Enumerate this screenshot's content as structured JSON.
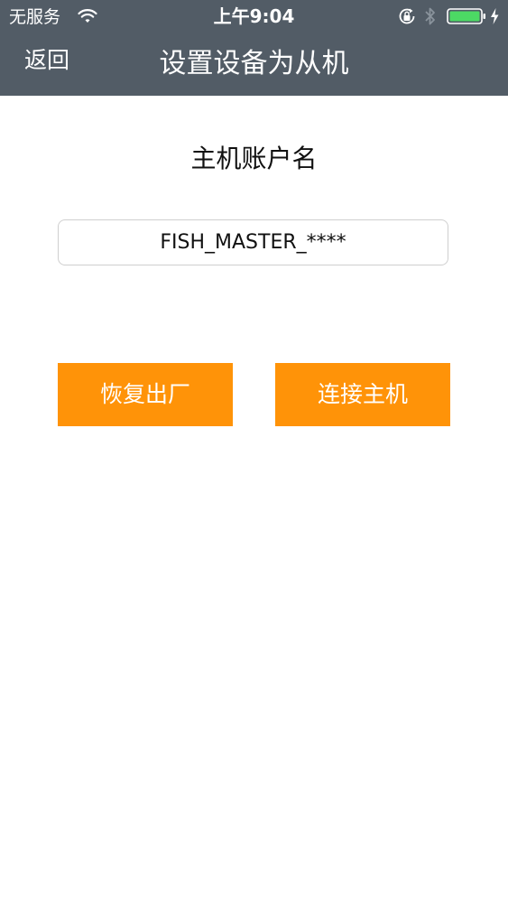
{
  "status_bar": {
    "carrier": "无服务",
    "time": "上午9:04",
    "icons": [
      "wifi-icon",
      "orientation-lock-icon",
      "bluetooth-icon",
      "battery-icon",
      "charging-icon"
    ],
    "battery_color": "#4cd964"
  },
  "nav_bar": {
    "back_label": "返回",
    "title": "设置设备为从机",
    "background_color": "#525c66"
  },
  "form": {
    "label": "主机账户名",
    "account_value": "FISH_MASTER_****"
  },
  "actions": {
    "reset_label": "恢复出厂",
    "connect_label": "连接主机",
    "button_color": "#ff9308"
  }
}
